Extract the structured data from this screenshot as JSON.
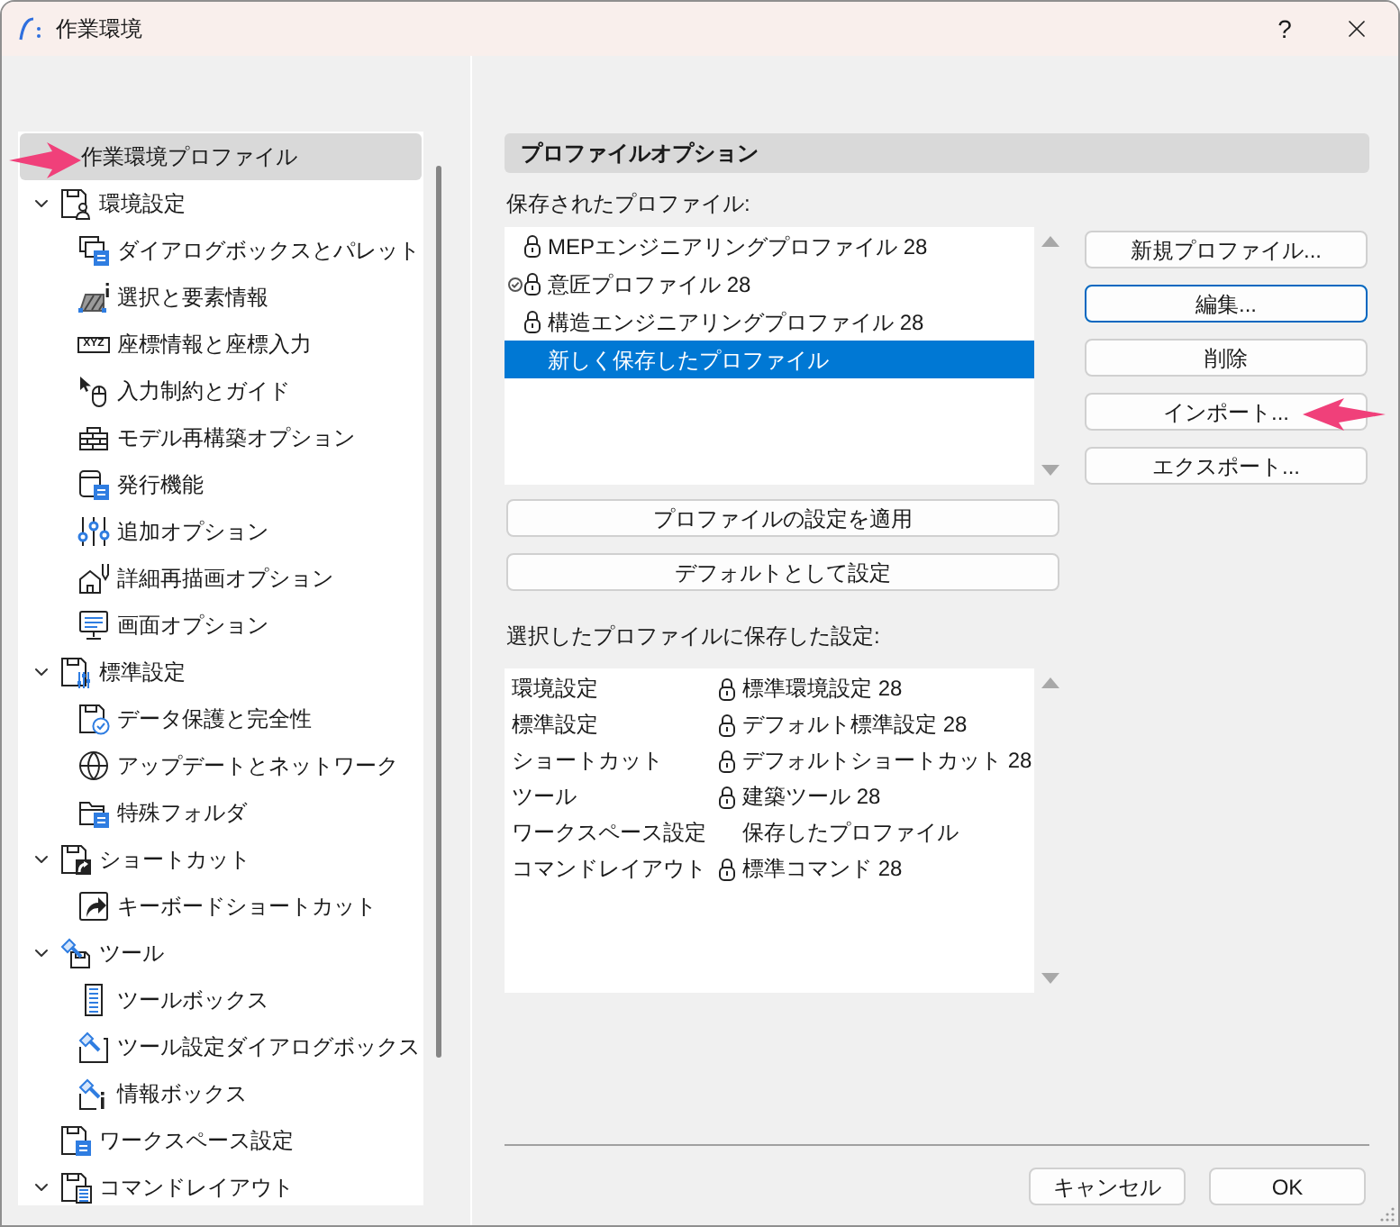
{
  "window": {
    "title": "作業環境",
    "help": "?"
  },
  "sidebar": {
    "items": [
      {
        "label": "作業環境プロファイル",
        "selected": true
      },
      {
        "label": "環境設定",
        "selected": false,
        "expanded": true,
        "children": [
          {
            "label": "ダイアログボックスとパレット",
            "selected": false
          },
          {
            "label": "選択と要素情報",
            "selected": false
          },
          {
            "label": "座標情報と座標入力",
            "selected": false,
            "icon_text": "XYZ"
          },
          {
            "label": "入力制約とガイド",
            "selected": false
          },
          {
            "label": "モデル再構築オプション",
            "selected": false
          },
          {
            "label": "発行機能",
            "selected": false
          },
          {
            "label": "追加オプション",
            "selected": false
          },
          {
            "label": "詳細再描画オプション",
            "selected": false
          },
          {
            "label": "画面オプション",
            "selected": false
          }
        ]
      },
      {
        "label": "標準設定",
        "selected": false,
        "expanded": true,
        "children": [
          {
            "label": "データ保護と完全性",
            "selected": false
          },
          {
            "label": "アップデートとネットワーク",
            "selected": false
          },
          {
            "label": "特殊フォルダ",
            "selected": false
          }
        ]
      },
      {
        "label": "ショートカット",
        "selected": false,
        "expanded": true,
        "children": [
          {
            "label": "キーボードショートカット",
            "selected": false
          }
        ]
      },
      {
        "label": "ツール",
        "selected": false,
        "expanded": true,
        "children": [
          {
            "label": "ツールボックス",
            "selected": false
          },
          {
            "label": "ツール設定ダイアログボックス",
            "selected": false
          },
          {
            "label": "情報ボックス",
            "selected": false
          }
        ]
      },
      {
        "label": "ワークスペース設定",
        "selected": false
      },
      {
        "label": "コマンドレイアウト",
        "selected": false,
        "expanded": true
      }
    ]
  },
  "profile_options": {
    "title": "プロファイルオプション",
    "saved_label": "保存されたプロファイル:",
    "profiles": [
      {
        "label": "MEPエンジニアリングプロファイル 28",
        "locked": true,
        "active": false,
        "selected": false
      },
      {
        "label": "意匠プロファイル 28",
        "locked": true,
        "active": true,
        "selected": false
      },
      {
        "label": "構造エンジニアリングプロファイル 28",
        "locked": true,
        "active": false,
        "selected": false
      },
      {
        "label": "新しく保存したプロファイル",
        "locked": false,
        "active": false,
        "selected": true
      }
    ],
    "profile_buttons": [
      {
        "label": "新規プロファイル...",
        "focused": false
      },
      {
        "label": "編集...",
        "focused": true
      },
      {
        "label": "削除",
        "focused": false
      },
      {
        "label": "インポート...",
        "focused": false
      },
      {
        "label": "エクスポート...",
        "focused": false
      }
    ],
    "apply_buttons": [
      "プロファイルの設定を適用",
      "デフォルトとして設定"
    ],
    "contents_label": "選択したプロファイルに保存した設定:",
    "contents": [
      {
        "category": "環境設定",
        "profile": "標準環境設定 28",
        "locked": true
      },
      {
        "category": "標準設定",
        "profile": "デフォルト標準設定 28",
        "locked": true
      },
      {
        "category": "ショートカット",
        "profile": "デフォルトショートカット 28",
        "locked": true
      },
      {
        "category": "ツール",
        "profile": "建築ツール 28",
        "locked": true
      },
      {
        "category": "ワークスペース設定",
        "profile": "保存したプロファイル",
        "locked": false
      },
      {
        "category": "コマンドレイアウト",
        "profile": "標準コマンド 28",
        "locked": true
      }
    ]
  },
  "footer": {
    "buttons": [
      "キャンセル",
      "OK"
    ]
  }
}
